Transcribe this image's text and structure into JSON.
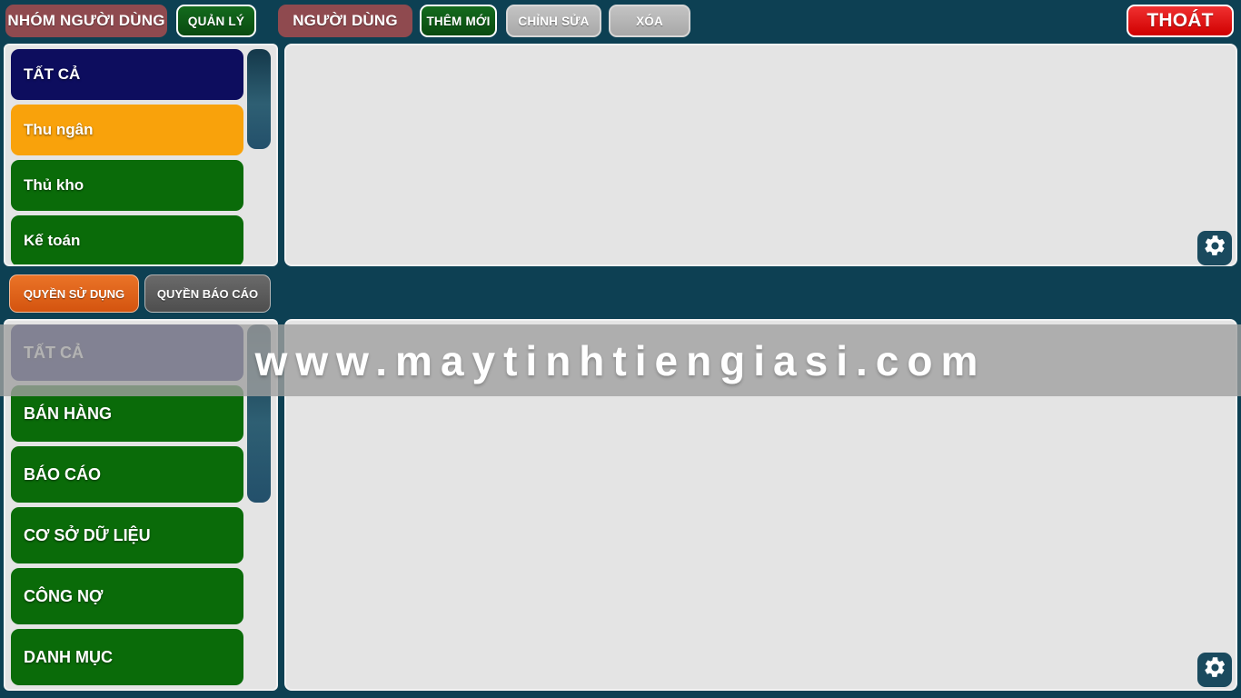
{
  "colors": {
    "background": "#0d4053",
    "panel": "#e4e4e4",
    "panel_border": "#f2f2f2",
    "title_maroon": "#8f4a4f",
    "green": "#0a6b09",
    "navy": "#0d0d5e",
    "orange": "#f9a20b",
    "exit_red": "#cf0000",
    "tab_active_orange": "#d4540f",
    "tab_inactive_grey": "#4e4e4e",
    "scrollbar_thumb": "#2e5f73",
    "gear_bg": "#1a4a5e"
  },
  "toolbar": {
    "group_title": "NHÓM NGƯỜI DÙNG",
    "manage_label": "QUẢN LÝ",
    "user_title": "NGƯỜI DÙNG",
    "add_label": "THÊM MỚI",
    "edit_label": "CHỈNH SỬA",
    "delete_label": "XÓA",
    "exit_label": "THOÁT"
  },
  "user_groups": {
    "items": [
      {
        "label": "TẤT CẢ",
        "style": "li-navy"
      },
      {
        "label": "Thu ngân",
        "style": "li-orange"
      },
      {
        "label": "Thủ kho",
        "style": "li-green"
      },
      {
        "label": "Kế toán",
        "style": "li-green"
      }
    ],
    "scroll": {
      "thumb_top": 0,
      "thumb_height": 110
    }
  },
  "permission_tabs": {
    "usage_label": "QUYỀN SỬ DỤNG",
    "report_label": "QUYỀN BÁO CÁO",
    "active": "usage"
  },
  "permissions": {
    "items": [
      {
        "label": "TẤT CẢ",
        "style": "li-navy"
      },
      {
        "label": "BÁN HÀNG",
        "style": "li-green"
      },
      {
        "label": "BÁO CÁO",
        "style": "li-green"
      },
      {
        "label": "CƠ SỞ DỮ LIỆU",
        "style": "li-green"
      },
      {
        "label": "CÔNG NỢ",
        "style": "li-green"
      },
      {
        "label": "DANH MỤC",
        "style": "li-green"
      }
    ],
    "scroll": {
      "thumb_top": 0,
      "thumb_height": 196
    }
  },
  "content_panels": {
    "top_detail": "",
    "bottom_detail": ""
  },
  "gear_icons": {
    "top": "gear-icon",
    "bottom": "gear-icon"
  },
  "watermark": {
    "text": "www.maytinhtiengiasi.com"
  }
}
